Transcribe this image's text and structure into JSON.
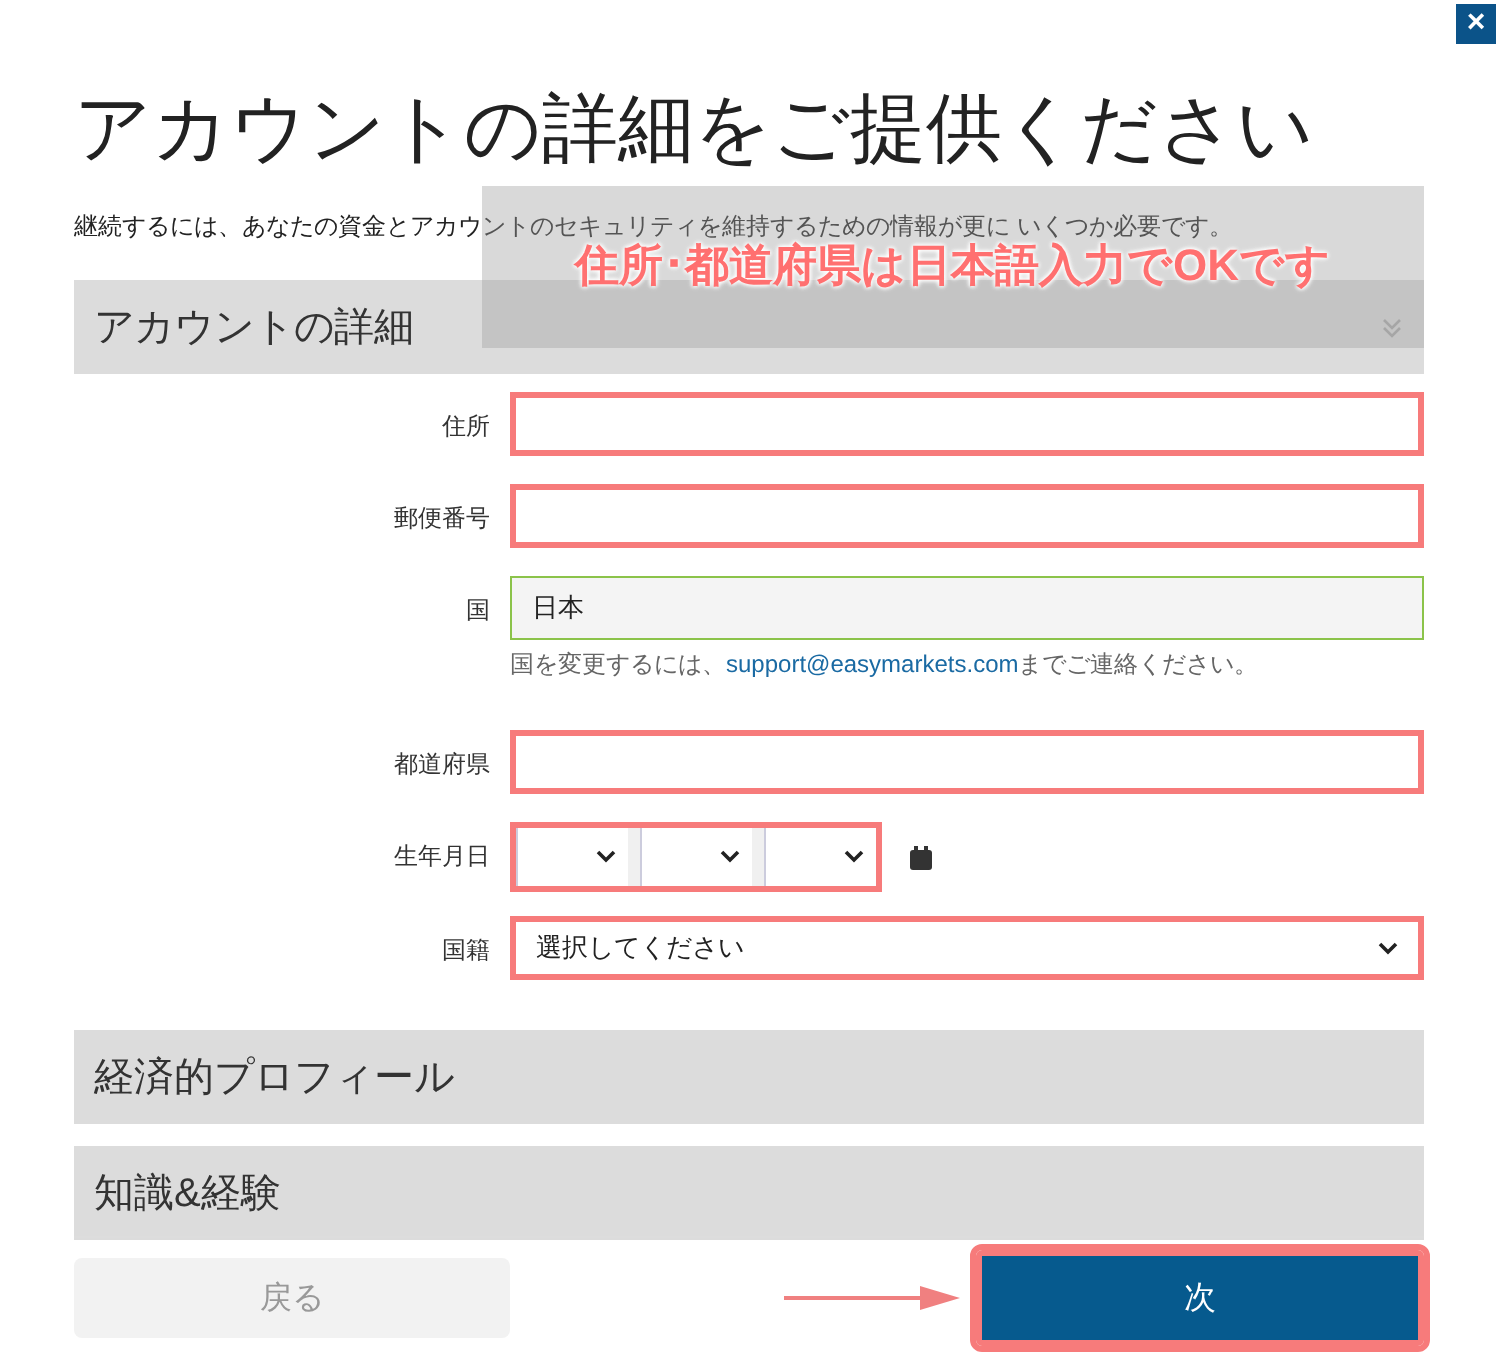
{
  "close_button": "×",
  "title": "アカウントの詳細をご提供ください",
  "subtitle": "継続するには、あなたの資金とアカウントのセキュリティを維持するための情報が更に いくつか必要です。",
  "annotation_banner": "住所･都道府県は日本語入力でOKです",
  "sections": [
    {
      "title": "アカウントの詳細",
      "expanded": true,
      "fields": [
        {
          "kind": "text",
          "label": "住所",
          "highlighted": true
        },
        {
          "kind": "text",
          "label": "郵便番号",
          "highlighted": true
        },
        {
          "kind": "readonly",
          "label": "国",
          "value": "日本",
          "highlighted": false,
          "hint_before": "国を変更するには、",
          "hint_link": "support@easymarkets.com",
          "hint_after": "までご連絡ください。"
        },
        {
          "kind": "text",
          "label": "都道府県",
          "highlighted": true
        },
        {
          "kind": "date",
          "label": "生年月日",
          "highlighted": true
        },
        {
          "kind": "select",
          "label": "国籍",
          "value": "選択してください",
          "highlighted": true
        }
      ]
    },
    {
      "title": "経済的プロフィール",
      "expanded": false
    },
    {
      "title": "知識&経験",
      "expanded": false
    }
  ],
  "buttons": {
    "back": {
      "label": "戻る",
      "disabled": true
    },
    "next": {
      "label": "次",
      "highlighted": true
    }
  }
}
